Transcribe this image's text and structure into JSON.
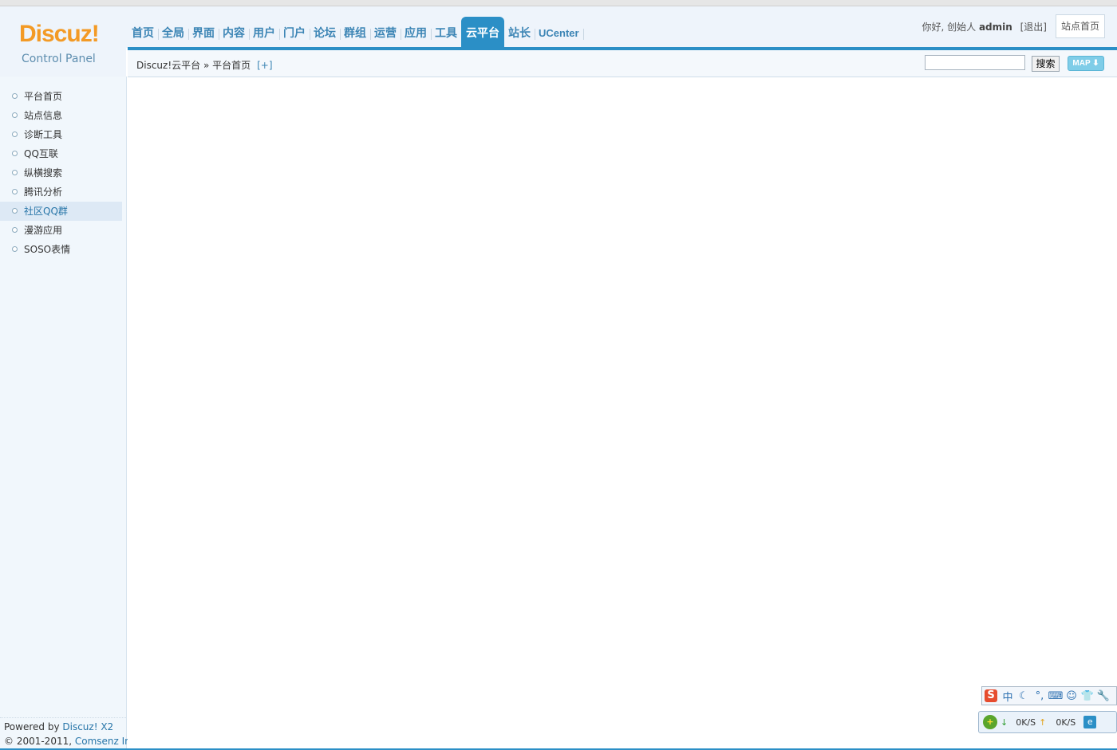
{
  "logo": {
    "brand": "Discuz!",
    "subtitle": "Control Panel"
  },
  "nav": {
    "items": [
      {
        "label": "首页"
      },
      {
        "label": "全局"
      },
      {
        "label": "界面"
      },
      {
        "label": "内容"
      },
      {
        "label": "用户"
      },
      {
        "label": "门户"
      },
      {
        "label": "论坛"
      },
      {
        "label": "群组"
      },
      {
        "label": "运营"
      },
      {
        "label": "应用"
      },
      {
        "label": "工具"
      },
      {
        "label": "云平台"
      },
      {
        "label": "站长"
      },
      {
        "label": "UCenter"
      }
    ],
    "active": "云平台"
  },
  "user": {
    "greeting": "你好, 创始人",
    "name": "admin",
    "logout": "[退出]",
    "site_home": "站点首页"
  },
  "breadcrumb": {
    "text": "Discuz!云平台 » 平台首页",
    "add": "[+]"
  },
  "search": {
    "button": "搜索",
    "map": "MAP ⬇"
  },
  "sidebar": {
    "items": [
      {
        "label": "平台首页"
      },
      {
        "label": "站点信息"
      },
      {
        "label": "诊断工具"
      },
      {
        "label": "QQ互联"
      },
      {
        "label": "纵横搜索"
      },
      {
        "label": "腾讯分析"
      },
      {
        "label": "社区QQ群"
      },
      {
        "label": "漫游应用"
      },
      {
        "label": "SOSO表情"
      }
    ],
    "active": "社区QQ群"
  },
  "footer": {
    "powered_prefix": "Powered by ",
    "powered_link": "Discuz! X2",
    "copyright_prefix": "© 2001-2011, ",
    "copyright_link": "Comsenz Inc."
  },
  "tray": {
    "ime_items": [
      "中",
      "☾",
      "°,",
      "⌨",
      "☺",
      "👕",
      "🔧"
    ],
    "ime_logo": "S",
    "down_speed": "0K/S",
    "up_speed": "0K/S"
  },
  "colors": {
    "accent": "#2b8fc6",
    "brand_orange": "#f39a25",
    "sidebar_bg": "#f1f7fc"
  }
}
